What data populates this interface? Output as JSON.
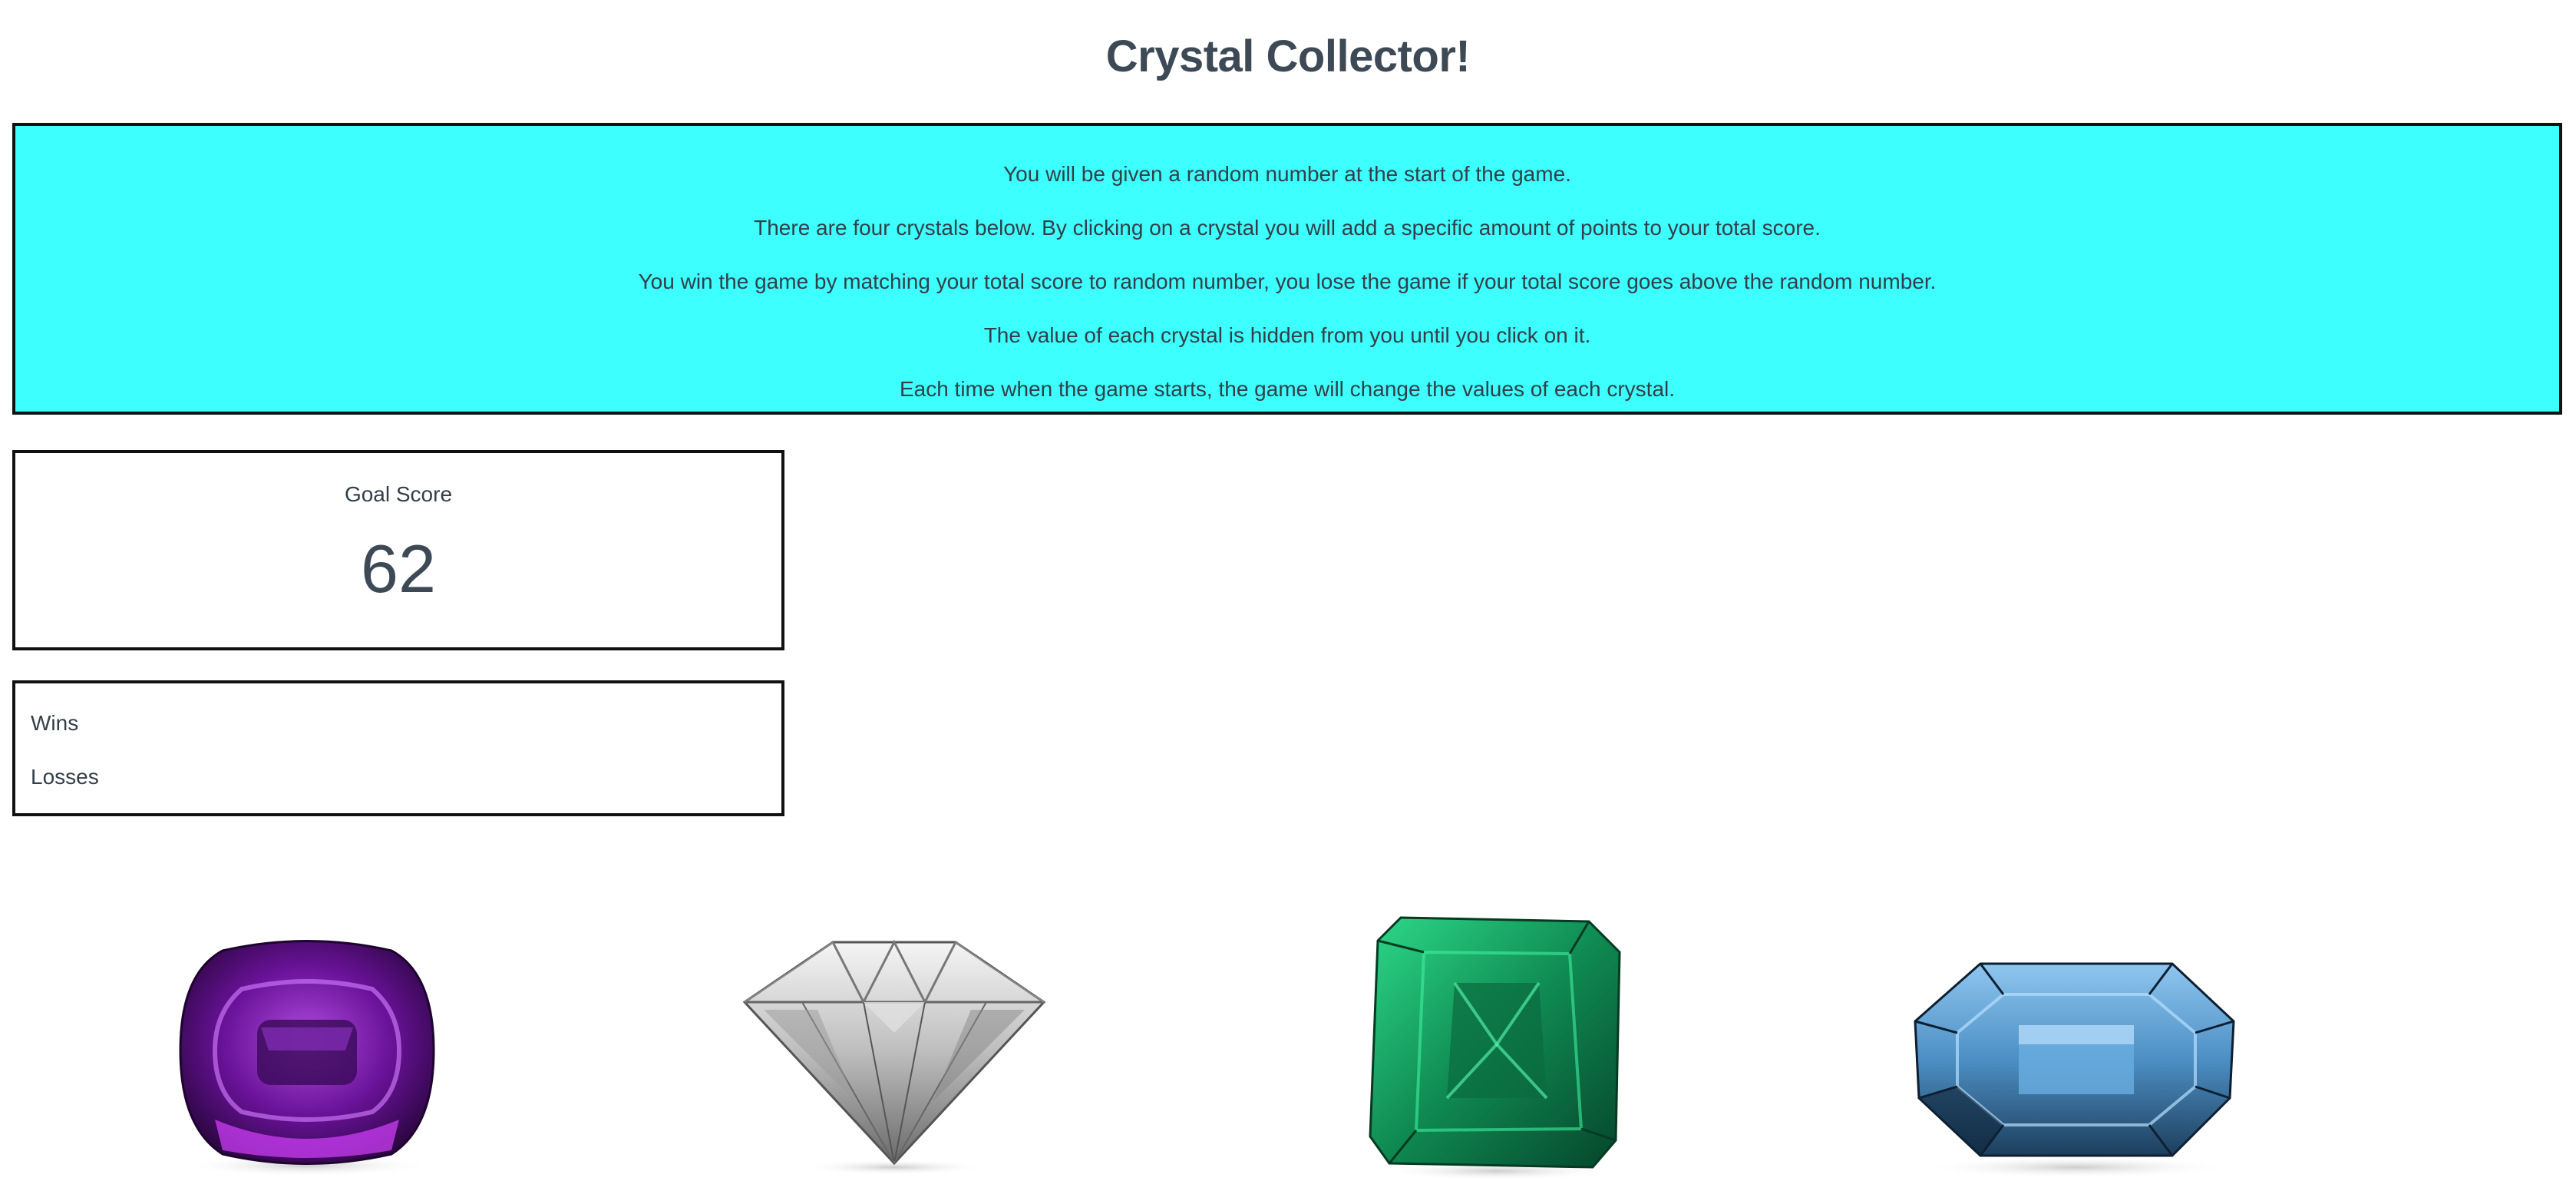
{
  "title": "Crystal Collector!",
  "instructions": [
    "You will be given a random number at the start of the game.",
    "There are four crystals below. By clicking on a crystal you will add a specific amount of points to your total score.",
    "You win the game by matching your total score to random number, you lose the game if your total score goes above the random number.",
    "The value of each crystal is hidden from you until you click on it.",
    "Each time when the game starts, the game will change the values of each crystal."
  ],
  "goal": {
    "label": "Goal Score",
    "value": "62"
  },
  "stats": {
    "wins_label": "Wins",
    "losses_label": "Losses"
  },
  "crystals": [
    {
      "name": "purple-crystal-icon",
      "color": "#7a1fb0"
    },
    {
      "name": "diamond-crystal-icon",
      "color": "#d8d8d8"
    },
    {
      "name": "emerald-crystal-icon",
      "color": "#1fa86a"
    },
    {
      "name": "aquamarine-crystal-icon",
      "color": "#6aaee0"
    }
  ],
  "colors": {
    "instructions_bg": "#3cfffe",
    "text": "#3d4a56",
    "border": "#111111"
  }
}
